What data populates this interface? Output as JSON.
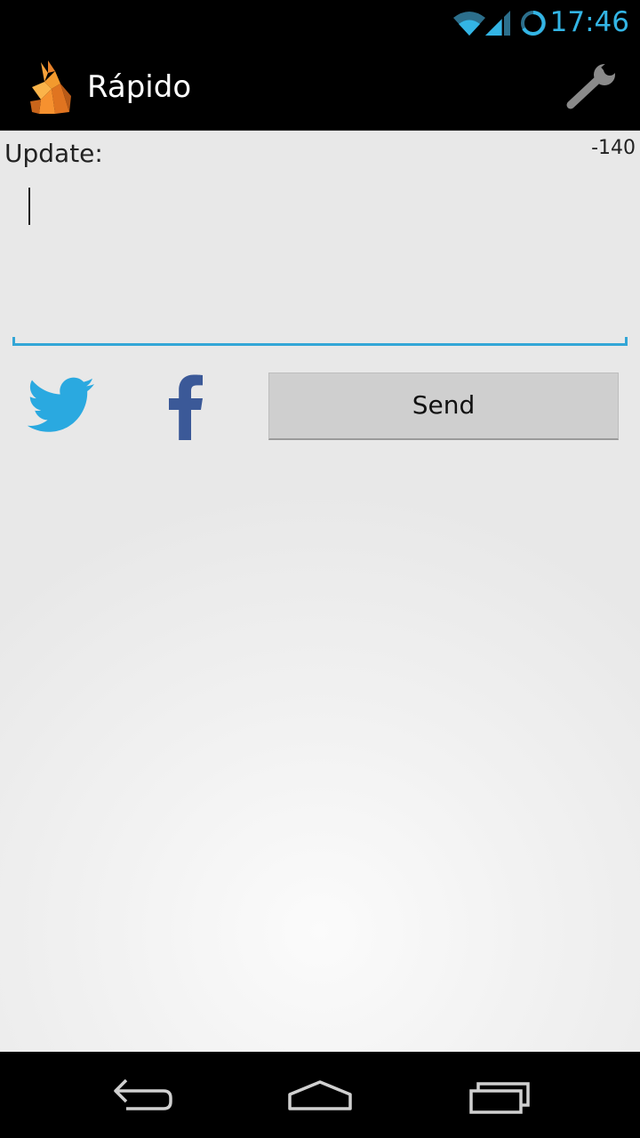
{
  "status_bar": {
    "time": "17:46",
    "icons": [
      "wifi-icon",
      "signal-icon",
      "sync-icon"
    ],
    "accent_color": "#33b5e5"
  },
  "action_bar": {
    "title": "Rápido",
    "logo_icon": "origami-rabbit-logo",
    "settings_icon": "wrench-icon"
  },
  "compose": {
    "label": "Update:",
    "counter": "-140",
    "input_value": "",
    "focus_color": "#33a6d6"
  },
  "networks": [
    {
      "name": "twitter",
      "icon": "twitter-bird-icon",
      "color": "#2aa9e0"
    },
    {
      "name": "facebook",
      "icon": "facebook-f-icon",
      "color": "#3b5998"
    }
  ],
  "send_button": {
    "label": "Send"
  },
  "nav_bar": {
    "buttons": [
      "back-icon",
      "home-icon",
      "recents-icon"
    ]
  }
}
